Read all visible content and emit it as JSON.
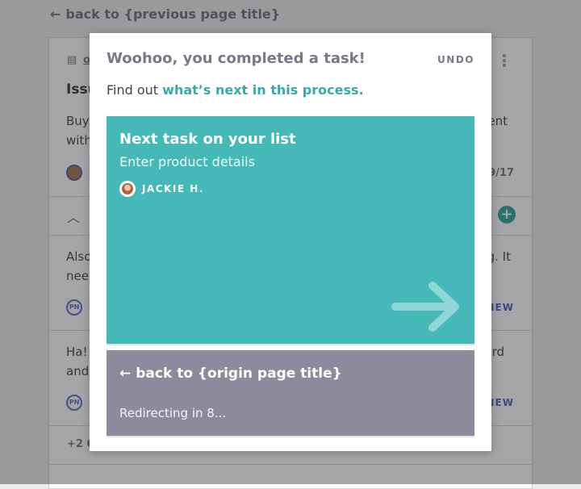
{
  "background": {
    "back_link": "back to {previous page title}",
    "card_label": "o",
    "title": "Issu",
    "body_line1": "Buy",
    "body_line1_right": "ent",
    "body_line2": "with",
    "date_fragment": "9/17",
    "comment1_line1": "Also",
    "comment1_line1_right": "g. It",
    "comment1_line2": "nee",
    "comment2_line1": "Ha!",
    "comment2_line1_right": "rd",
    "comment2_line2": "and",
    "avatar_initials": "PN",
    "new_label": "NEW",
    "more_comments": "+2 C"
  },
  "modal": {
    "title": "Woohoo, you completed a task!",
    "undo_label": "UNDO",
    "find_out_prefix": "Find out",
    "find_out_link": "what’s next in this process.",
    "next_card": {
      "heading": "Next task on your list",
      "task_name": "Enter product details",
      "assignee": "JACKIE H."
    },
    "back_card": {
      "link": "back to {origin page title}",
      "redirect_text": "Redirecting in 8..."
    }
  },
  "colors": {
    "accent_teal": "#45b8b8",
    "link_teal": "#3aa9a6",
    "back_card_grey": "#8b8b9b",
    "new_label_blue": "#4a5fbd"
  }
}
